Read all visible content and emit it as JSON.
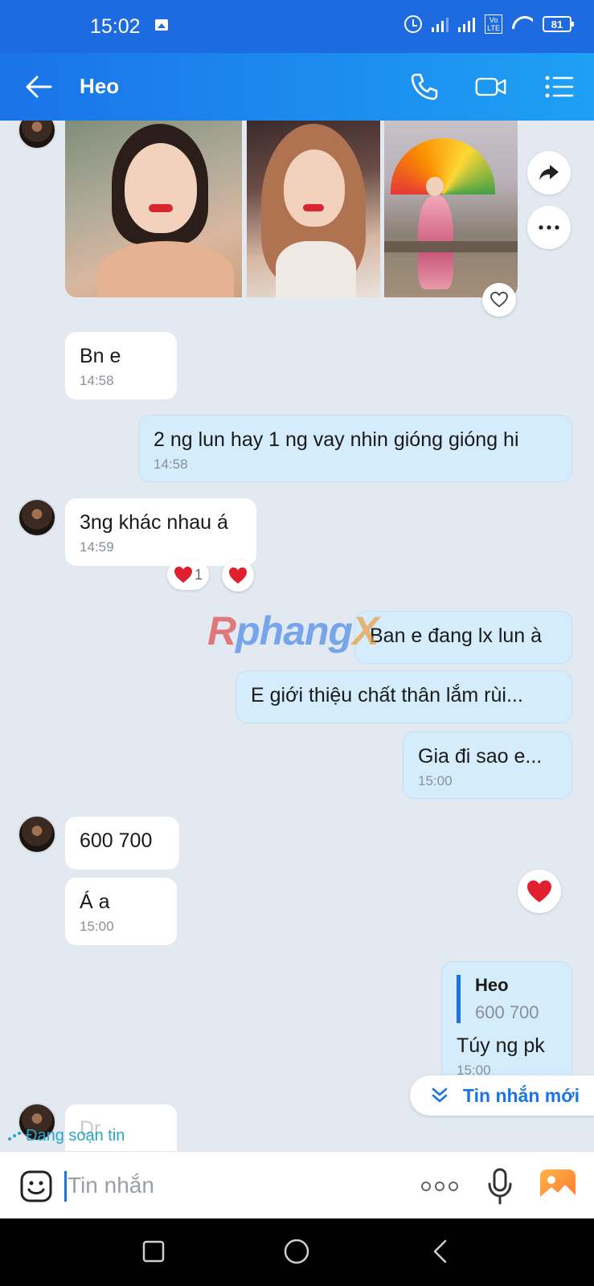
{
  "status_bar": {
    "time": "15:02",
    "network_label_top": "Vo",
    "network_label_bottom": "LTE",
    "battery": "81"
  },
  "header": {
    "contact_name": "Heo"
  },
  "messages": {
    "m1": {
      "text": "Bn e",
      "time": "14:58"
    },
    "m2": {
      "text": "2 ng lun hay 1 ng vay nhin gióng gióng hi",
      "time": "14:58"
    },
    "m3": {
      "text": "3ng khác nhau á",
      "time": "14:59",
      "reaction_count": "1"
    },
    "m4": {
      "text": "Ban e đang lx lun à"
    },
    "m5": {
      "text": "E giới thiệu chất thân lắm rùi..."
    },
    "m6": {
      "text": "Gia đi sao e...",
      "time": "15:00"
    },
    "m7": {
      "text": "600  700"
    },
    "m8": {
      "text": "Á a",
      "time": "15:00"
    },
    "m9": {
      "quote_name": "Heo",
      "quote_text": "600  700",
      "text": "Túy ng pk",
      "time": "15:00"
    },
    "m10": {
      "text": "Dr"
    }
  },
  "watermark": {
    "part_a": "R",
    "part_b": "phang",
    "part_c": "X"
  },
  "new_messages_label": "Tin nhắn mới",
  "typing_label": "Đang soạn tin",
  "input": {
    "placeholder": "Tin nhắn"
  },
  "colors": {
    "header": "#1a73e8",
    "status_bar": "#1e6ae0",
    "outgoing_bubble": "#d4ecfb",
    "incoming_bubble": "#ffffff",
    "chat_background": "#e2e9f1",
    "accent": "#1a73e8"
  }
}
